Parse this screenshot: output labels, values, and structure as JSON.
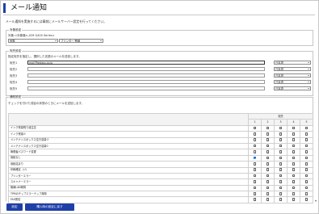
{
  "page": {
    "title": "メール通知",
    "description": "メール通知を実施するには事前にメールサーバー設定を行ってください。"
  },
  "target_section": {
    "legend": "対象設定",
    "device_label": "対象:<対象機>-JCM Q400 Series>",
    "model_select": "伊藤",
    "status_select": "プリンター 警報"
  },
  "address_section": {
    "legend": "宛先設定",
    "instruction": "指定宛先を指定し、選択した言語のメールを送信します。",
    "rows": [
      {
        "label": "宛先1",
        "value": "mail'Ptestsss.co.jp",
        "language": "日本語"
      },
      {
        "label": "宛先2",
        "value": "",
        "language": "日本語"
      },
      {
        "label": "宛先3",
        "value": "",
        "language": "日本語"
      },
      {
        "label": "宛先4",
        "value": "",
        "language": "日本語"
      },
      {
        "label": "宛先5",
        "value": "",
        "language": "日本語"
      }
    ]
  },
  "notify_section": {
    "legend": "通知設定",
    "instruction": "チェックを付けた項目の状態のときにメールを送信します。",
    "group_header": "宛先",
    "columns": [
      "1",
      "2",
      "3",
      "4",
      "5"
    ],
    "rows": [
      {
        "label": "インク残量残り減注意",
        "checked": [
          false,
          false,
          false,
          false,
          false
        ]
      },
      {
        "label": "インク残量少",
        "checked": [
          false,
          false,
          false,
          false,
          false
        ]
      },
      {
        "label": "メンテナンスボックス空き容量少",
        "checked": [
          false,
          false,
          false,
          false,
          false
        ]
      },
      {
        "label": "メンテナンスボックス空き容量0",
        "checked": [
          false,
          false,
          false,
          false,
          false
        ]
      },
      {
        "label": "管理者パスワード変更",
        "checked": [
          false,
          false,
          false,
          false,
          false
        ]
      },
      {
        "label": "用紙なし",
        "checked": [
          true,
          false,
          false,
          false,
          false
        ]
      },
      {
        "label": "用紙詰まり",
        "checked": [
          false,
          false,
          false,
          false,
          false
        ]
      },
      {
        "label": "印刷確定（ジ）",
        "checked": [
          false,
          false,
          false,
          false,
          false
        ]
      },
      {
        "label": "プリンターエラー",
        "checked": [
          false,
          false,
          false,
          false,
          false
        ]
      },
      {
        "label": "スキャナーエラー",
        "checked": [
          false,
          false,
          false,
          false,
          false
        ]
      },
      {
        "label": "無線LAN故障",
        "checked": [
          false,
          false,
          false,
          false,
          false
        ]
      },
      {
        "label": "TPMのチップエラーテップ故障",
        "checked": [
          false,
          false,
          false,
          false,
          false
        ]
      },
      {
        "label": "FAX受信",
        "checked": [
          false,
          false,
          false,
          false,
          false
        ]
      }
    ]
  },
  "buttons": {
    "apply": "設定",
    "reset": "購入時の設定に戻す"
  },
  "colors": {
    "accent": "#1f3fa8",
    "checkbox_checked": "#1a73e8"
  }
}
